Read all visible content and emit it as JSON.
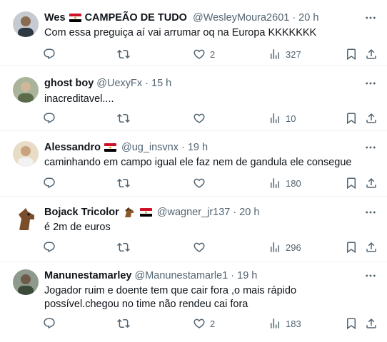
{
  "colors": {
    "text": "#0f1419",
    "secondary": "#536471",
    "divider": "#eff3f4"
  },
  "tweets": [
    {
      "name": "Wes",
      "flag": "egypt-flag-icon",
      "name_extra": "CAMPEÃO DE TUDO",
      "handle": "@WesleyMoura2601",
      "dot": "·",
      "time": "20 h",
      "text": "Com essa preguiça aí vai arrumar oq na Europa KKKKKKK",
      "reply_count": "",
      "retweet_count": "",
      "like_count": "2",
      "view_count": "327"
    },
    {
      "name": "ghost boy",
      "handle": "@UexyFx",
      "dot": "·",
      "time": "15 h",
      "text": "inacreditavel....",
      "reply_count": "",
      "retweet_count": "",
      "like_count": "",
      "view_count": "10"
    },
    {
      "name": "Alessandro",
      "flag": "egypt-flag-icon",
      "handle": "@ug_insvnx",
      "dot": "·",
      "time": "19 h",
      "text": "caminhando em campo igual ele faz nem de gandula ele consegue",
      "reply_count": "",
      "retweet_count": "",
      "like_count": "",
      "view_count": "180"
    },
    {
      "name": "Bojack Tricolor",
      "emoji": "horse-face-icon",
      "flag": "egypt-flag-icon",
      "handle": "@wagner_jr137",
      "dot": "·",
      "time": "20 h",
      "text": "é 2m de euros",
      "reply_count": "",
      "retweet_count": "",
      "like_count": "",
      "view_count": "296"
    },
    {
      "name": "Manunestamarley",
      "handle": "@Manunestamarle1",
      "dot": "·",
      "time": "19 h",
      "text": "Jogador ruim e doente tem que cair fora ,o mais rápido possível.chegou no time não rendeu cai fora",
      "reply_count": "",
      "retweet_count": "",
      "like_count": "2",
      "view_count": "183"
    }
  ]
}
